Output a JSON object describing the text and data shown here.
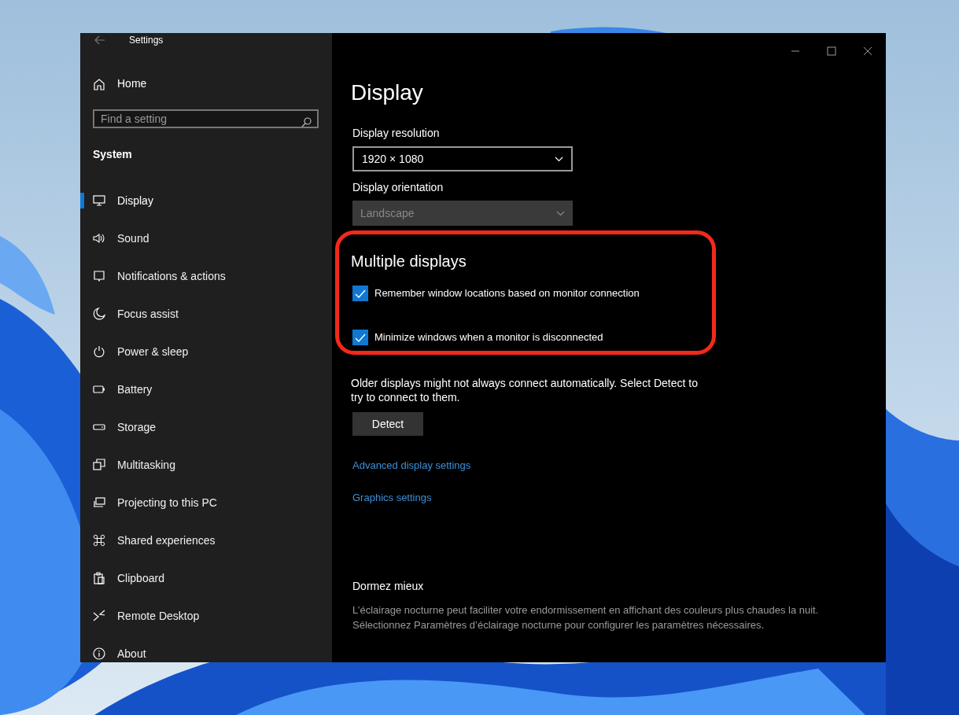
{
  "window": {
    "title": "Settings"
  },
  "sidebar": {
    "home": "Home",
    "search": {
      "placeholder": "Find a setting"
    },
    "section": "System",
    "items": [
      {
        "label": "Display",
        "selected": true
      },
      {
        "label": "Sound",
        "selected": false
      },
      {
        "label": "Notifications & actions",
        "selected": false
      },
      {
        "label": "Focus assist",
        "selected": false
      },
      {
        "label": "Power & sleep",
        "selected": false
      },
      {
        "label": "Battery",
        "selected": false
      },
      {
        "label": "Storage",
        "selected": false
      },
      {
        "label": "Multitasking",
        "selected": false
      },
      {
        "label": "Projecting to this PC",
        "selected": false
      },
      {
        "label": "Shared experiences",
        "selected": false
      },
      {
        "label": "Clipboard",
        "selected": false
      },
      {
        "label": "Remote Desktop",
        "selected": false
      },
      {
        "label": "About",
        "selected": false
      }
    ]
  },
  "content": {
    "title": "Display",
    "resolution": {
      "label": "Display resolution",
      "value": "1920 × 1080",
      "disabled": false
    },
    "orientation": {
      "label": "Display orientation",
      "value": "Landscape",
      "disabled": true
    },
    "multiple_displays": {
      "heading": "Multiple displays",
      "checkboxes": [
        {
          "label": "Remember window locations based on monitor connection",
          "checked": true
        },
        {
          "label": "Minimize windows when a monitor is disconnected",
          "checked": true
        }
      ]
    },
    "detect_note": "Older displays might not always connect automatically. Select Detect to try to connect to them.",
    "detect_button": "Detect",
    "links": [
      "Advanced display settings",
      "Graphics settings"
    ],
    "sleep": {
      "heading": "Dormez mieux",
      "text": "L’éclairage nocturne peut faciliter votre endormissement en affichant des couleurs plus chaudes la nuit. Sélectionnez Paramètres d’éclairage nocturne pour configurer les paramètres nécessaires."
    }
  }
}
